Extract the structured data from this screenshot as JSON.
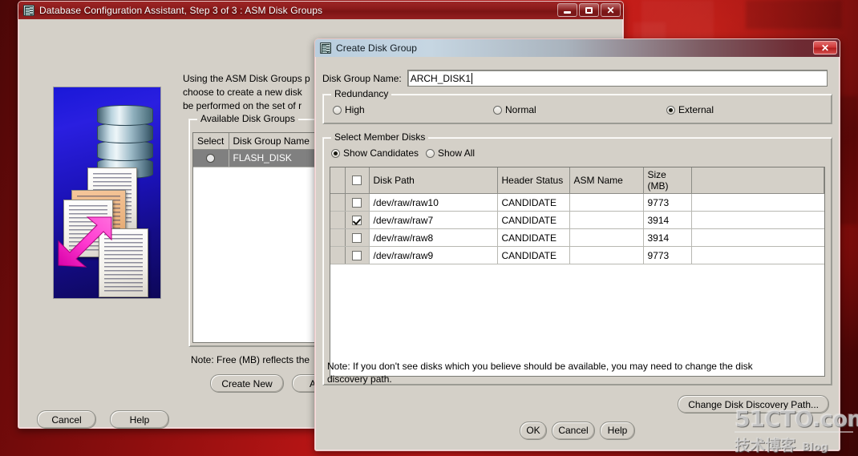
{
  "desktop": {
    "background_color": "#b81515"
  },
  "dbca_window": {
    "title": "Database Configuration Assistant, Step 3 of 3 : ASM Disk Groups",
    "icon": "database-icon",
    "minimize_label": "Minimize",
    "maximize_label": "Maximize",
    "close_label": "Close",
    "description": "Using the ASM Disk Groups p\nchoose to create a new disk\nbe performed on the set of r",
    "available_disk_groups": {
      "legend": "Available Disk Groups",
      "columns": [
        "Select",
        "Disk Group Name"
      ],
      "rows": [
        {
          "selected": true,
          "name": "FLASH_DISK"
        }
      ]
    },
    "note": "Note: Free (MB) reflects the",
    "buttons": {
      "create_new": "Create New",
      "add_disks": "Add Disk",
      "cancel": "Cancel",
      "help": "Help"
    }
  },
  "create_disk_group_dialog": {
    "title": "Create Disk Group",
    "icon": "database-icon",
    "close_label": "Close",
    "disk_group_name": {
      "label": "Disk Group Name:",
      "value": "ARCH_DISK1"
    },
    "redundancy": {
      "legend": "Redundancy",
      "options": [
        {
          "label": "High",
          "selected": false
        },
        {
          "label": "Normal",
          "selected": false
        },
        {
          "label": "External",
          "selected": true
        }
      ]
    },
    "select_member_disks": {
      "legend": "Select Member Disks",
      "filter_options": [
        {
          "label": "Show Candidates",
          "selected": true
        },
        {
          "label": "Show All",
          "selected": false
        }
      ],
      "columns": [
        "",
        "Disk Path",
        "Header Status",
        "ASM Name",
        "Size (MB)"
      ],
      "header_checkbox_checked": false,
      "rows": [
        {
          "checked": false,
          "disk_path": "/dev/raw/raw10",
          "header_status": "CANDIDATE",
          "asm_name": "",
          "size_mb": "9773"
        },
        {
          "checked": true,
          "disk_path": "/dev/raw/raw7",
          "header_status": "CANDIDATE",
          "asm_name": "",
          "size_mb": "3914"
        },
        {
          "checked": false,
          "disk_path": "/dev/raw/raw8",
          "header_status": "CANDIDATE",
          "asm_name": "",
          "size_mb": "3914"
        },
        {
          "checked": false,
          "disk_path": "/dev/raw/raw9",
          "header_status": "CANDIDATE",
          "asm_name": "",
          "size_mb": "9773"
        }
      ]
    },
    "discovery_note": "Note: If you don't see disks which you believe should be available, you may need to change the disk discovery path.",
    "change_path_button": "Change Disk Discovery Path...",
    "buttons": {
      "ok": "OK",
      "cancel": "Cancel",
      "help": "Help"
    }
  },
  "watermark": {
    "site": "51CTO.com",
    "subtitle": "技术博客",
    "blog": "Blog"
  }
}
